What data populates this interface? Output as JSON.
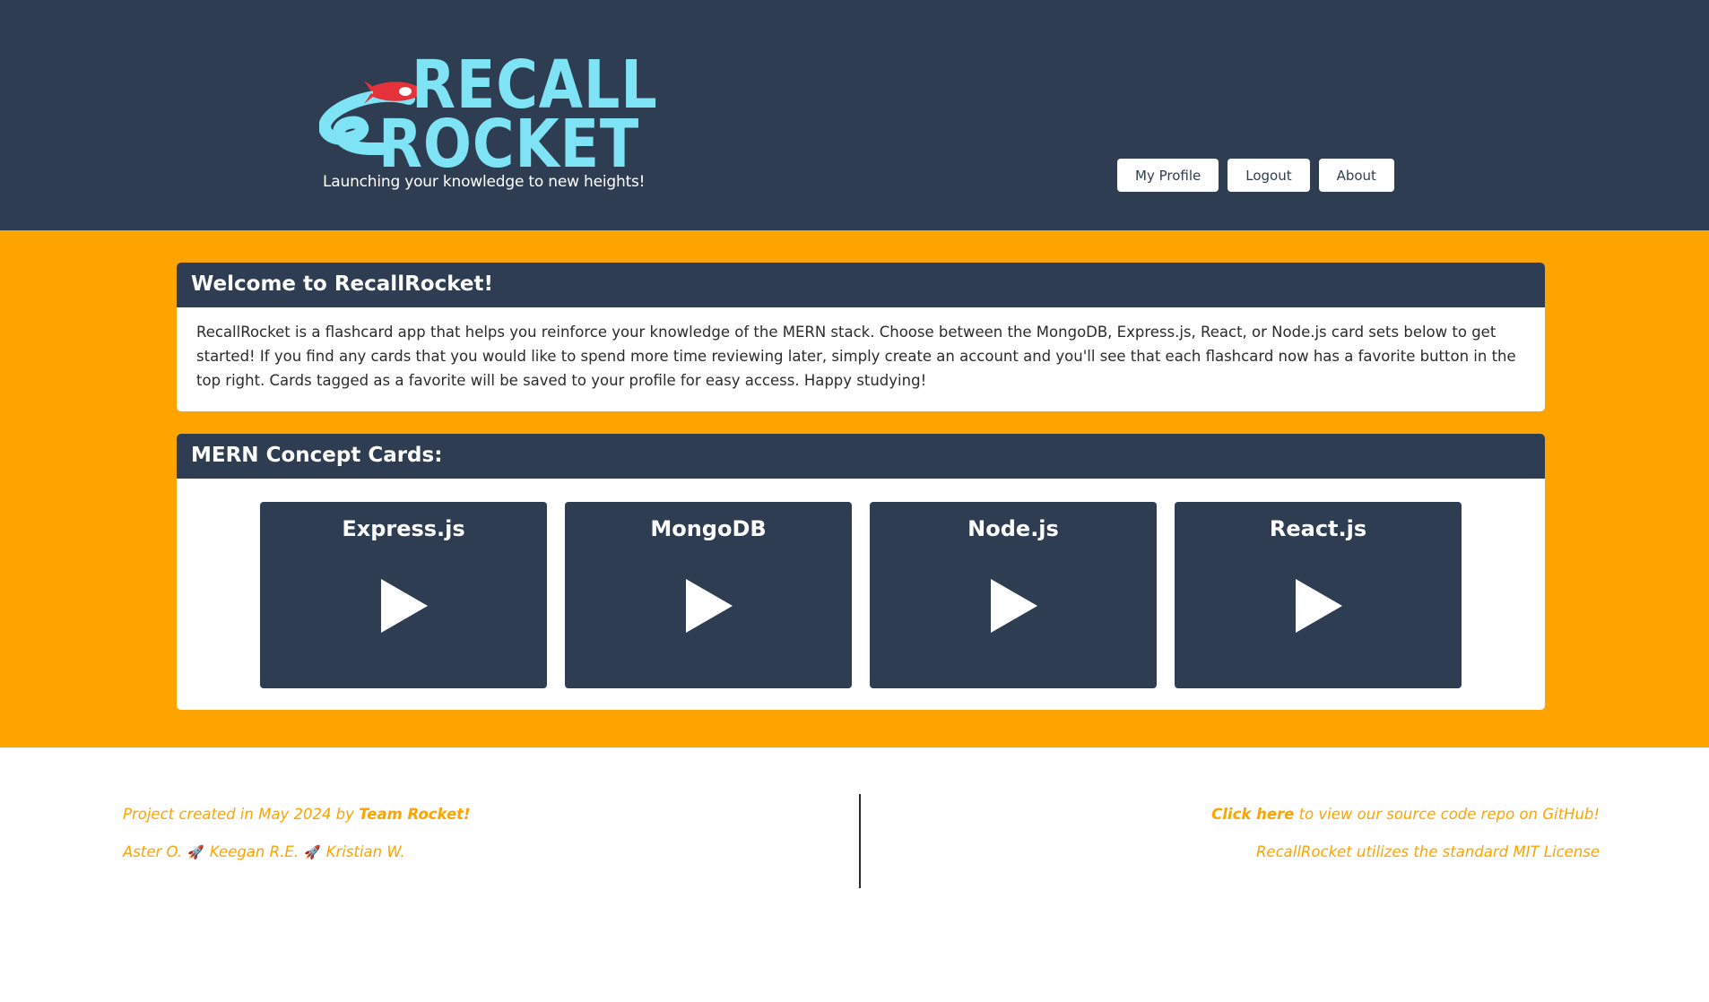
{
  "header": {
    "logo_line1": "RECALL",
    "logo_line2": "ROCKET",
    "tagline": "Launching your knowledge to new heights!",
    "nav": {
      "profile": "My Profile",
      "logout": "Logout",
      "about": "About"
    }
  },
  "welcome": {
    "title": "Welcome to RecallRocket!",
    "body": "RecallRocket is a flashcard app that helps you reinforce your knowledge of the MERN stack. Choose between the MongoDB, Express.js, React, or Node.js card sets below to get started! If you find any cards that you would like to spend more time reviewing later, simply create an account and you'll see that each flashcard now has a favorite button in the top right. Cards tagged as a favorite will be saved to your profile for easy access. Happy studying!"
  },
  "concepts": {
    "title": "MERN Concept Cards:",
    "cards": [
      {
        "label": "Express.js"
      },
      {
        "label": "MongoDB"
      },
      {
        "label": "Node.js"
      },
      {
        "label": "React.js"
      }
    ]
  },
  "footer": {
    "created_prefix": "Project created in May 2024 by ",
    "team": "Team Rocket!",
    "members": [
      "Aster O.",
      "Keegan R.E.",
      "Kristian W."
    ],
    "separator_emoji": "🚀",
    "link_text": "Click here",
    "link_suffix": " to view our source code repo on GitHub!",
    "license": "RecallRocket utilizes the standard MIT License"
  },
  "colors": {
    "navy": "#2e3d51",
    "orange": "#fea400",
    "logo_cyan": "#7ee3f4",
    "rocket_red": "#e5323a"
  }
}
